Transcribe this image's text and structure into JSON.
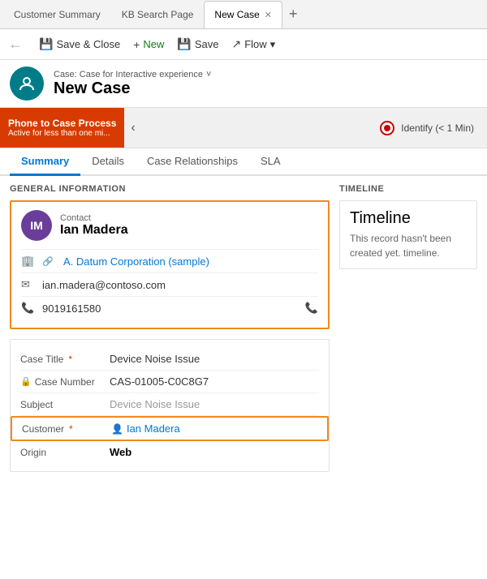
{
  "tabs": [
    {
      "label": "Customer Summary",
      "active": false,
      "closeable": false
    },
    {
      "label": "KB Search Page",
      "active": false,
      "closeable": false
    },
    {
      "label": "New Case",
      "active": true,
      "closeable": true
    }
  ],
  "toolbar": {
    "back_icon": "←",
    "save_close_label": "Save & Close",
    "new_label": "New",
    "save_label": "Save",
    "flow_label": "Flow",
    "flow_dropdown": "▾"
  },
  "header": {
    "avatar_initials": "✦",
    "breadcrumb": "Case: Case for Interactive experience",
    "breadcrumb_dropdown": "˅",
    "title": "New Case"
  },
  "process": {
    "label_title": "Phone to Case Process",
    "label_subtitle": "Active for less than one mi...",
    "step_label": "Identify",
    "step_time": "(< 1 Min)"
  },
  "nav_tabs": [
    {
      "label": "Summary",
      "active": true
    },
    {
      "label": "Details",
      "active": false
    },
    {
      "label": "Case Relationships",
      "active": false
    },
    {
      "label": "SLA",
      "active": false
    }
  ],
  "general_info": {
    "section_title": "GENERAL INFORMATION"
  },
  "contact": {
    "avatar_initials": "IM",
    "label": "Contact",
    "name": "Ian Madera",
    "company_icon": "🏢",
    "company_link_icon": "🔗",
    "company": "A. Datum Corporation (sample)",
    "email_icon": "✉",
    "email": "ian.madera@contoso.com",
    "phone_icon": "📞",
    "phone": "9019161580",
    "phone_call_icon": "📞"
  },
  "case_fields": {
    "case_title_label": "Case Title",
    "case_title_value": "Device Noise Issue",
    "case_number_label": "Case Number",
    "case_number_value": "CAS-01005-C0C8G7",
    "subject_label": "Subject",
    "subject_value": "Device Noise Issue",
    "customer_label": "Customer",
    "customer_icon": "👤",
    "customer_value": "Ian Madera",
    "origin_label": "Origin",
    "origin_value": "Web"
  },
  "timeline": {
    "section_title": "TIMELINE",
    "title": "Timeline",
    "empty_text": "This record hasn't been created yet. timeline."
  }
}
